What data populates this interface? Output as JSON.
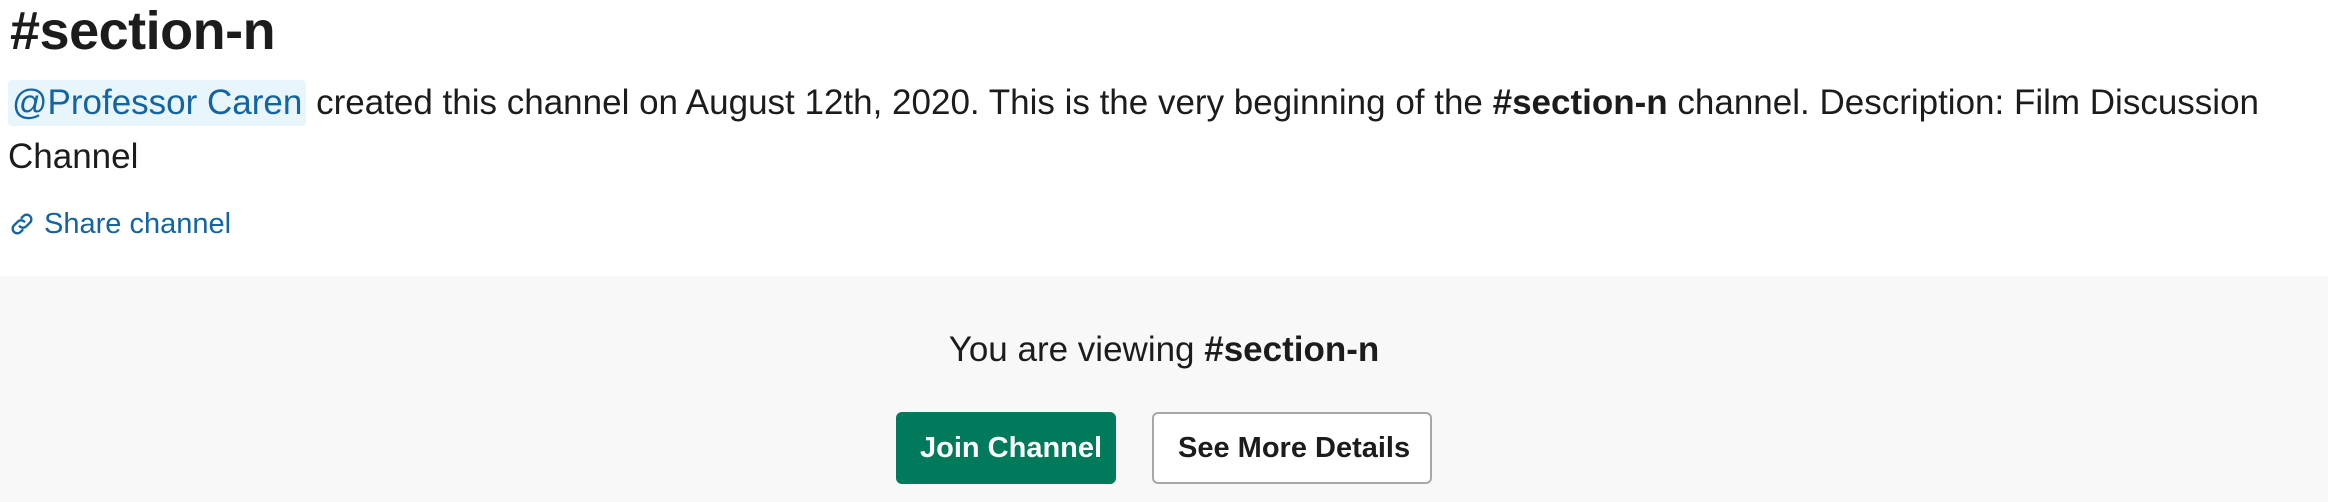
{
  "channel": {
    "title": "#section-n",
    "creator_mention": "@Professor Caren",
    "created_text": " created this channel on August 12th, 2020. This is the very beginning of the ",
    "channel_bold": "#section-n",
    "description_text": " channel. Description: Film Discussion Channel",
    "share_label": "Share channel"
  },
  "join_panel": {
    "viewing_prefix": "You are viewing ",
    "viewing_channel": "#section-n",
    "join_label": "Join Channel",
    "details_label": "See More Details"
  },
  "colors": {
    "link": "#1264a3",
    "mention_bg": "#e8f5fa",
    "join_button": "#007a5a",
    "panel_bg": "#f8f8f8"
  }
}
